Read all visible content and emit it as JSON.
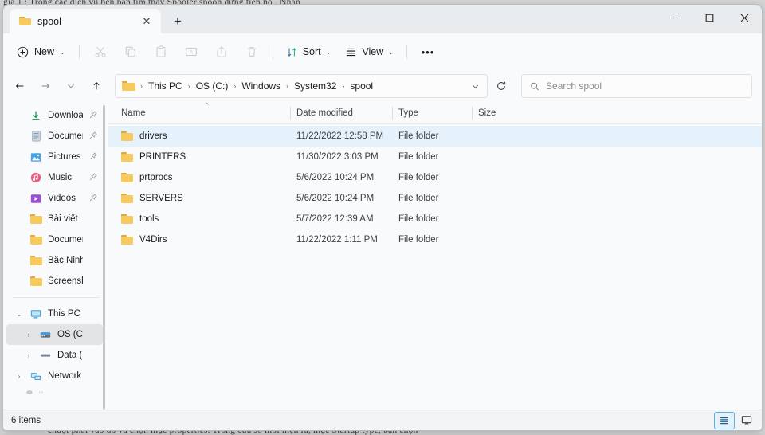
{
  "background": {
    "top_text": "gia 1 : Trong các dịch vụ bên bạn tìm thấy Spooler spoon dừng tiến nó . Nhấn",
    "bottom_text": "chuột phải vào đó và chọn mục properties. Trong cửa sổ mới hiện ra, mục Startup type, bạn chọn"
  },
  "titlebar": {
    "tabs": [
      {
        "label": "spool",
        "icon": "folder-icon",
        "close_label": "✕",
        "active": true
      }
    ],
    "new_tab_label": "+",
    "window_controls": {
      "minimize": "minimize-icon",
      "maximize": "maximize-icon",
      "close": "close-icon"
    }
  },
  "toolbar": {
    "new_label": "New",
    "new_chevron": "⌄",
    "actions": [
      {
        "name": "cut-button",
        "icon": "scissors-icon",
        "disabled": true
      },
      {
        "name": "copy-button",
        "icon": "copy-icon",
        "disabled": true
      },
      {
        "name": "paste-button",
        "icon": "paste-icon",
        "disabled": true
      },
      {
        "name": "rename-button",
        "icon": "rename-icon",
        "disabled": true
      },
      {
        "name": "share-button",
        "icon": "share-icon",
        "disabled": true
      },
      {
        "name": "delete-button",
        "icon": "trash-icon",
        "disabled": true
      }
    ],
    "sort_label": "Sort",
    "view_label": "View",
    "more_label": "•••"
  },
  "addressbar": {
    "back_icon": "arrow-left-icon",
    "forward_icon": "arrow-right-icon",
    "recent_icon": "chevron-down-icon",
    "up_icon": "arrow-up-icon",
    "folder_icon": "folder-icon",
    "crumbs": [
      "This PC",
      "OS (C:)",
      "Windows",
      "System32",
      "spool"
    ],
    "separator": "›",
    "dropdown_icon": "chevron-down-icon",
    "refresh_icon": "refresh-icon"
  },
  "search": {
    "icon": "search-icon",
    "placeholder": "Search spool",
    "value": ""
  },
  "sidebar": {
    "quick_access": [
      {
        "label": "Downloads",
        "icon": "downloads-icon",
        "pinned": true,
        "pin": "📌"
      },
      {
        "label": "Documents",
        "icon": "documents-icon",
        "pinned": true,
        "pin": "📌"
      },
      {
        "label": "Pictures",
        "icon": "pictures-icon",
        "pinned": true,
        "pin": "📌"
      },
      {
        "label": "Music",
        "icon": "music-icon",
        "pinned": true,
        "pin": "📌"
      },
      {
        "label": "Videos",
        "icon": "videos-icon",
        "pinned": true,
        "pin": "📌"
      },
      {
        "label": "Bài viết",
        "icon": "folder-icon",
        "pinned": false,
        "pin": ""
      },
      {
        "label": "Documents",
        "icon": "folder-icon",
        "pinned": false,
        "pin": ""
      },
      {
        "label": "Bắc Ninh_XDMH",
        "icon": "folder-icon",
        "pinned": false,
        "pin": ""
      },
      {
        "label": "Screenshots",
        "icon": "folder-icon",
        "pinned": false,
        "pin": ""
      }
    ],
    "tree": [
      {
        "label": "This PC",
        "icon": "pc-icon",
        "expander": "⌄",
        "expanded": true,
        "selected": false,
        "indent": 0
      },
      {
        "label": "OS (C:)",
        "icon": "drive-os-icon",
        "expander": "›",
        "expanded": false,
        "selected": true,
        "indent": 1
      },
      {
        "label": "Data (D:)",
        "icon": "drive-icon",
        "expander": "›",
        "expanded": false,
        "selected": false,
        "indent": 1
      },
      {
        "label": "Network",
        "icon": "network-icon",
        "expander": "›",
        "expanded": false,
        "selected": false,
        "indent": 0
      }
    ]
  },
  "filelist": {
    "columns": [
      {
        "key": "name",
        "label": "Name",
        "sorted": true,
        "sort_dir": "asc",
        "sort_glyph": "⌃"
      },
      {
        "key": "date",
        "label": "Date modified",
        "sorted": false
      },
      {
        "key": "type",
        "label": "Type",
        "sorted": false
      },
      {
        "key": "size",
        "label": "Size",
        "sorted": false
      }
    ],
    "rows": [
      {
        "name": "drivers",
        "date": "11/22/2022 12:58 PM",
        "type": "File folder",
        "size": "",
        "icon": "folder-icon",
        "hovered": true
      },
      {
        "name": "PRINTERS",
        "date": "11/30/2022 3:03 PM",
        "type": "File folder",
        "size": "",
        "icon": "folder-icon",
        "hovered": false
      },
      {
        "name": "prtprocs",
        "date": "5/6/2022 10:24 PM",
        "type": "File folder",
        "size": "",
        "icon": "folder-icon",
        "hovered": false
      },
      {
        "name": "SERVERS",
        "date": "5/6/2022 10:24 PM",
        "type": "File folder",
        "size": "",
        "icon": "folder-icon",
        "hovered": false
      },
      {
        "name": "tools",
        "date": "5/7/2022 12:39 AM",
        "type": "File folder",
        "size": "",
        "icon": "folder-icon",
        "hovered": false
      },
      {
        "name": "V4Dirs",
        "date": "11/22/2022 1:11 PM",
        "type": "File folder",
        "size": "",
        "icon": "folder-icon",
        "hovered": false
      }
    ]
  },
  "statusbar": {
    "item_count": "6 items",
    "details_view_icon": "details-view-icon",
    "large_icons_view_icon": "large-icons-view-icon",
    "active_view": "details"
  },
  "colors": {
    "accent": "#59b0e8",
    "row_hover": "#e5f1fb",
    "folder_body": "#f7ca60",
    "folder_tab": "#e3a93c",
    "window_bg": "#f9fafb",
    "titlebar_bg": "#e9ecef"
  }
}
